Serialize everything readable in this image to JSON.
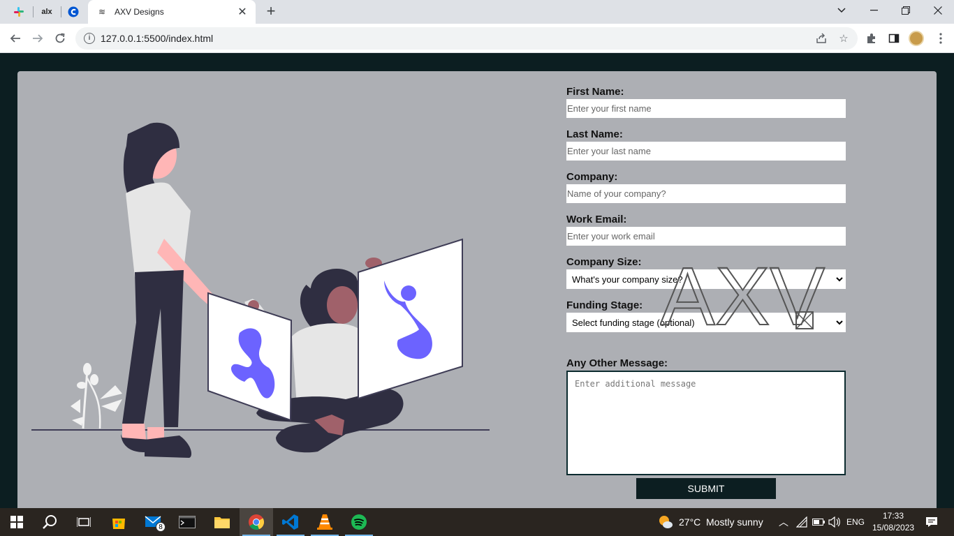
{
  "browser": {
    "active_tab_title": "AXV Designs",
    "pinned_tabs": [
      "slack",
      "alx",
      "coursera"
    ],
    "pinned_alx_label": "alx",
    "url": "127.0.0.1:5500/index.html"
  },
  "form": {
    "first_name": {
      "label": "First Name:",
      "placeholder": "Enter your first name"
    },
    "last_name": {
      "label": "Last Name:",
      "placeholder": "Enter your last name"
    },
    "company": {
      "label": "Company:",
      "placeholder": "Name of your company?"
    },
    "work_email": {
      "label": "Work Email:",
      "placeholder": "Enter your work email"
    },
    "company_size": {
      "label": "Company Size:",
      "selected": "What's your company size?"
    },
    "funding_stage": {
      "label": "Funding Stage:",
      "selected": "Select funding stage (optional)"
    },
    "message": {
      "label": "Any Other Message:",
      "placeholder": "Enter additional message"
    },
    "submit_label": "SUBMIT"
  },
  "logo": {
    "text": "AXV"
  },
  "taskbar": {
    "mail_badge": "8",
    "weather_temp": "27°C",
    "weather_desc": "Mostly sunny",
    "language": "ENG",
    "time": "17:33",
    "date": "15/08/2023"
  },
  "colors": {
    "page_bg": "#0c1e21",
    "card_bg": "#adafb4",
    "accent_purple": "#6c63ff",
    "skin": "#ffb6b6",
    "dark_clothes": "#2f2e41"
  }
}
